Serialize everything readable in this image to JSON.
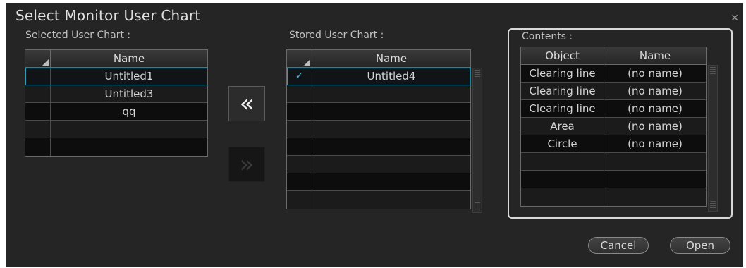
{
  "dialog": {
    "title": "Select Monitor User Chart",
    "close_glyph": "✕"
  },
  "selected": {
    "label": "Selected User Chart :",
    "header": {
      "name": "Name"
    },
    "rows": [
      {
        "name": "Untitled1",
        "selected": true
      },
      {
        "name": "Untitled3",
        "selected": false
      },
      {
        "name": "qq",
        "selected": false
      },
      {
        "name": "",
        "selected": false
      },
      {
        "name": "",
        "selected": false
      }
    ]
  },
  "move": {
    "to_selected_glyph": "«",
    "to_stored_glyph": "»"
  },
  "stored": {
    "label": "Stored User Chart :",
    "header": {
      "name": "Name"
    },
    "rows": [
      {
        "check": "✓",
        "name": "Untitled4",
        "selected": true
      },
      {
        "check": "",
        "name": ""
      },
      {
        "check": "",
        "name": ""
      },
      {
        "check": "",
        "name": ""
      },
      {
        "check": "",
        "name": ""
      },
      {
        "check": "",
        "name": ""
      },
      {
        "check": "",
        "name": ""
      },
      {
        "check": "",
        "name": ""
      }
    ]
  },
  "contents": {
    "label": "Contents :",
    "header": {
      "object": "Object",
      "name": "Name"
    },
    "rows": [
      {
        "object": "Clearing line",
        "name": "(no name)"
      },
      {
        "object": "Clearing line",
        "name": "(no name)"
      },
      {
        "object": "Clearing line",
        "name": "(no name)"
      },
      {
        "object": "Area",
        "name": "(no name)"
      },
      {
        "object": "Circle",
        "name": "(no name)"
      },
      {
        "object": "",
        "name": ""
      },
      {
        "object": "",
        "name": ""
      },
      {
        "object": "",
        "name": ""
      }
    ]
  },
  "buttons": {
    "cancel": "Cancel",
    "open": "Open"
  },
  "colors": {
    "accent": "#2aa0b8",
    "check": "#3fb8d8",
    "background": "#252525"
  }
}
